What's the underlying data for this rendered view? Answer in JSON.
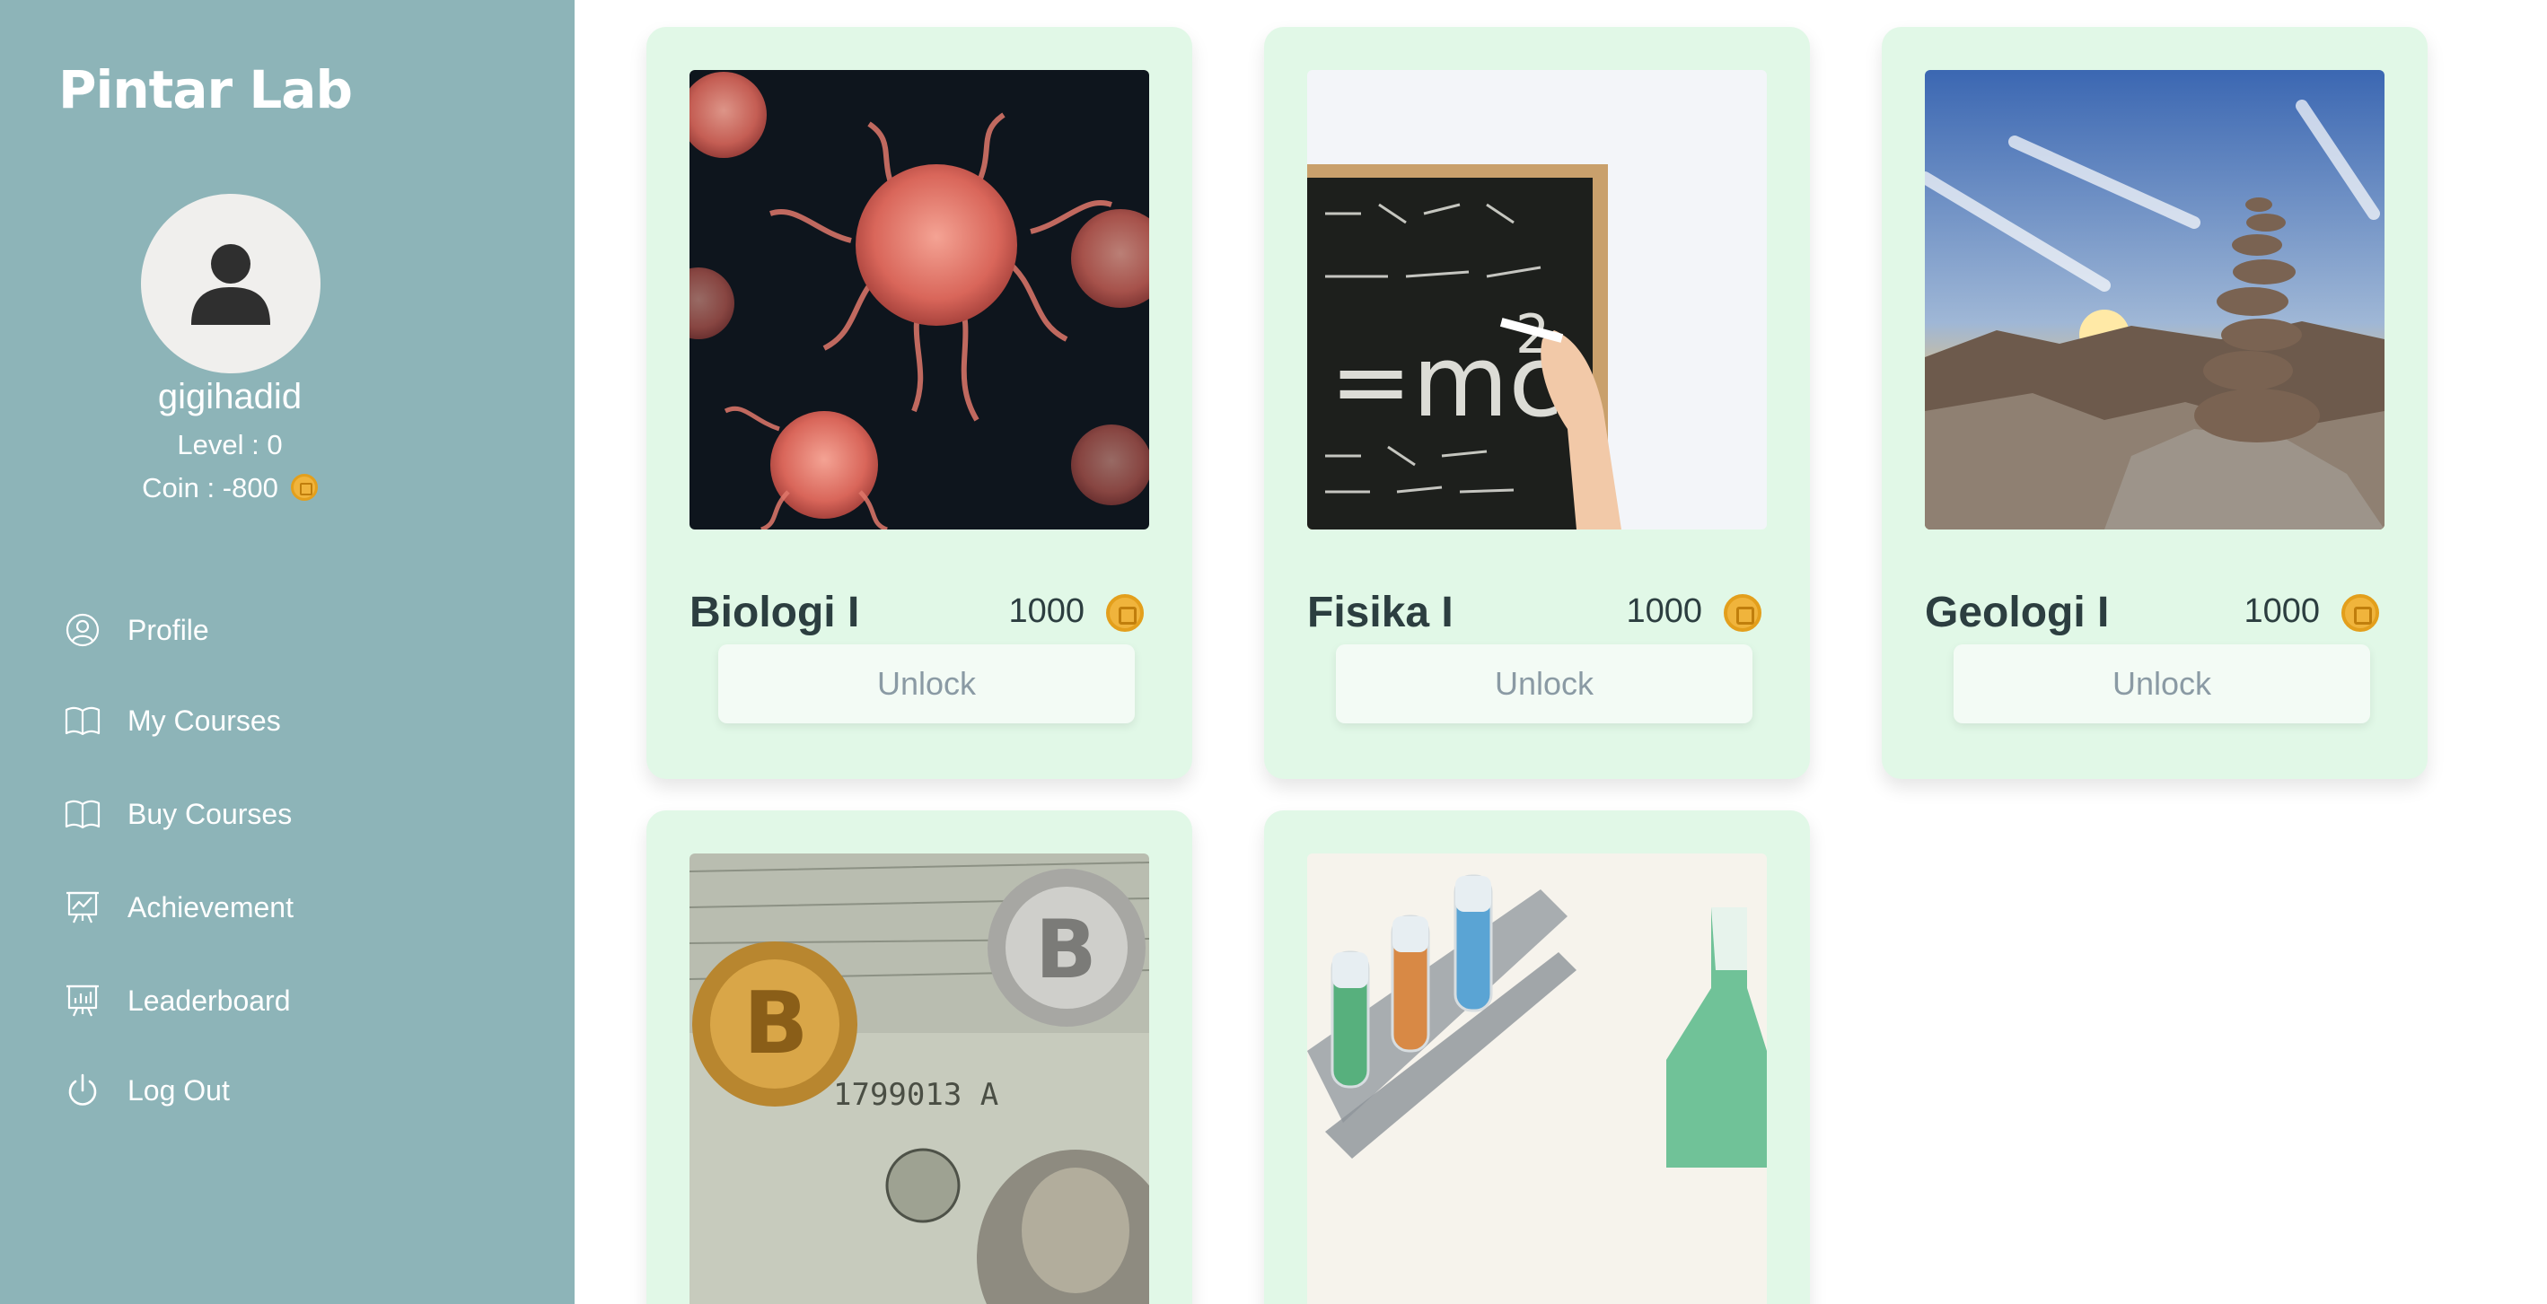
{
  "app": {
    "brand": "Pintar Lab"
  },
  "user": {
    "username": "gigihadid",
    "level_text": "Level : 0",
    "coin_text": "Coin : -800"
  },
  "nav": [
    {
      "label": "Profile",
      "icon": "user-circle-icon"
    },
    {
      "label": "My Courses",
      "icon": "book-icon"
    },
    {
      "label": "Buy Courses",
      "icon": "book-icon"
    },
    {
      "label": "Achievement",
      "icon": "chart-board-icon"
    },
    {
      "label": "Leaderboard",
      "icon": "bar-chart-board-icon"
    },
    {
      "label": "Log Out",
      "icon": "power-icon"
    }
  ],
  "courses": [
    {
      "title": "Biologi I",
      "price": "1000",
      "button": "Unlock",
      "image": "jellyfish-photo"
    },
    {
      "title": "Fisika I",
      "price": "1000",
      "button": "Unlock",
      "image": "chalkboard-photo"
    },
    {
      "title": "Geologi I",
      "price": "1000",
      "button": "Unlock",
      "image": "rock-cairn-photo"
    },
    {
      "title": "",
      "price": "",
      "button": "",
      "image": "bitcoin-dollar-photo"
    },
    {
      "title": "",
      "price": "",
      "button": "",
      "image": "test-tubes-photo"
    }
  ],
  "colors": {
    "sidebar": "#8db4b8",
    "card": "#e1f8e7",
    "coin": "#f0b43c"
  }
}
